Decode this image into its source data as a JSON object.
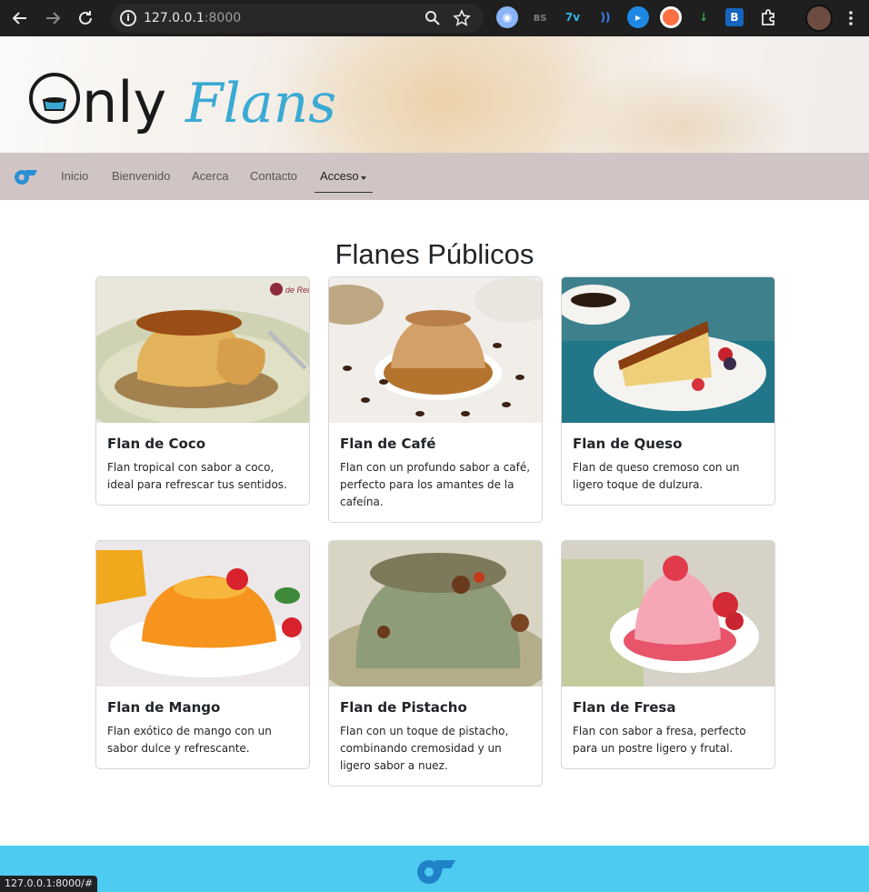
{
  "browser": {
    "url_host": "127.0.0.1",
    "url_port": ":8000",
    "status_url": "127.0.0.1:8000/#"
  },
  "brand": {
    "logo_only": "Only",
    "logo_flans": "Flans",
    "accent": "#3aaad4"
  },
  "nav": {
    "items": [
      {
        "label": "Inicio"
      },
      {
        "label": "Bienvenido"
      },
      {
        "label": "Acerca"
      },
      {
        "label": "Contacto"
      },
      {
        "label": "Acceso"
      }
    ]
  },
  "main": {
    "title": "Flanes Públicos",
    "watermark": "de Rechupete",
    "cards": [
      {
        "title": "Flan de Coco",
        "text": "Flan tropical con sabor a coco, ideal para refrescar tus sentidos."
      },
      {
        "title": "Flan de Café",
        "text": "Flan con un profundo sabor a café, perfecto para los amantes de la cafeína."
      },
      {
        "title": "Flan de Queso",
        "text": "Flan de queso cremoso con un ligero toque de dulzura."
      },
      {
        "title": "Flan de Mango",
        "text": "Flan exótico de mango con un sabor dulce y refrescante."
      },
      {
        "title": "Flan de Pistacho",
        "text": "Flan con un toque de pistacho, combinando cremosidad y un ligero sabor a nuez."
      },
      {
        "title": "Flan de Fresa",
        "text": "Flan con sabor a fresa, perfecto para un postre ligero y frutal."
      }
    ]
  },
  "colors": {
    "navbar_bg": "#d1c4c4",
    "footer_bg": "#4dcbf0"
  }
}
